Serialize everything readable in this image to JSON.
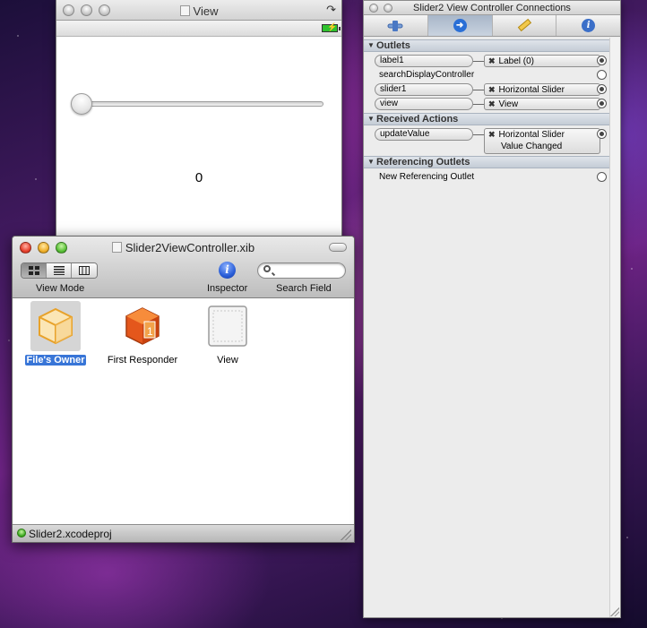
{
  "view_window": {
    "title": "View",
    "label_value": "0",
    "slider_value": 0
  },
  "xib_window": {
    "title": "Slider2ViewController.xib",
    "toolbar": {
      "view_mode_label": "View Mode",
      "inspector_label": "Inspector",
      "search_label": "Search Field",
      "search_placeholder": ""
    },
    "items": [
      {
        "label": "File's Owner",
        "icon": "cube-icon",
        "selected": true
      },
      {
        "label": "First Responder",
        "icon": "first-responder-icon",
        "selected": false
      },
      {
        "label": "View",
        "icon": "view-icon",
        "selected": false
      }
    ],
    "status_text": "Slider2.xcodeproj"
  },
  "inspector": {
    "title": "Slider2 View Controller Connections",
    "tabs": [
      "attributes-tab",
      "connections-tab",
      "size-tab",
      "identity-tab"
    ],
    "sections": {
      "outlets": "Outlets",
      "received_actions": "Received Actions",
      "referencing_outlets": "Referencing Outlets"
    },
    "outlets": [
      {
        "name": "label1",
        "target": "Label (0)",
        "connected": true
      },
      {
        "name": "searchDisplayController",
        "target": "",
        "connected": false
      },
      {
        "name": "slider1",
        "target": "Horizontal Slider",
        "connected": true
      },
      {
        "name": "view",
        "target": "View",
        "connected": true
      }
    ],
    "actions": [
      {
        "name": "updateValue",
        "target_line1": "Horizontal Slider",
        "target_line2": "Value Changed",
        "connected": true
      }
    ],
    "referencing": [
      {
        "name": "New Referencing Outlet",
        "connected": false
      }
    ]
  },
  "colors": {
    "selection": "#3875d7",
    "section_header": "#c4ccd6",
    "connections_tab": "#2a6fd6"
  }
}
